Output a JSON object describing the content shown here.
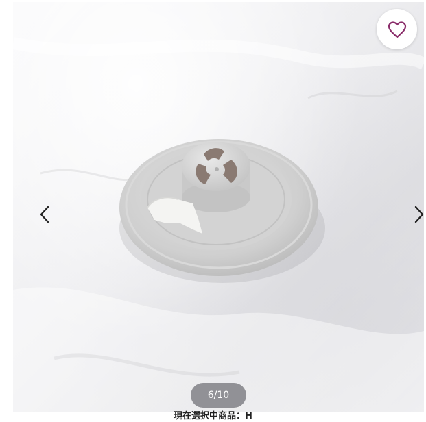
{
  "gallery": {
    "counter": "6/10",
    "caption": "現在選択中商品：H"
  },
  "icons": {
    "favorite": "heart-outline-icon",
    "previous": "chevron-left-icon",
    "next": "chevron-right-icon"
  },
  "colors": {
    "favorite_accent": "#8a2d6a"
  }
}
